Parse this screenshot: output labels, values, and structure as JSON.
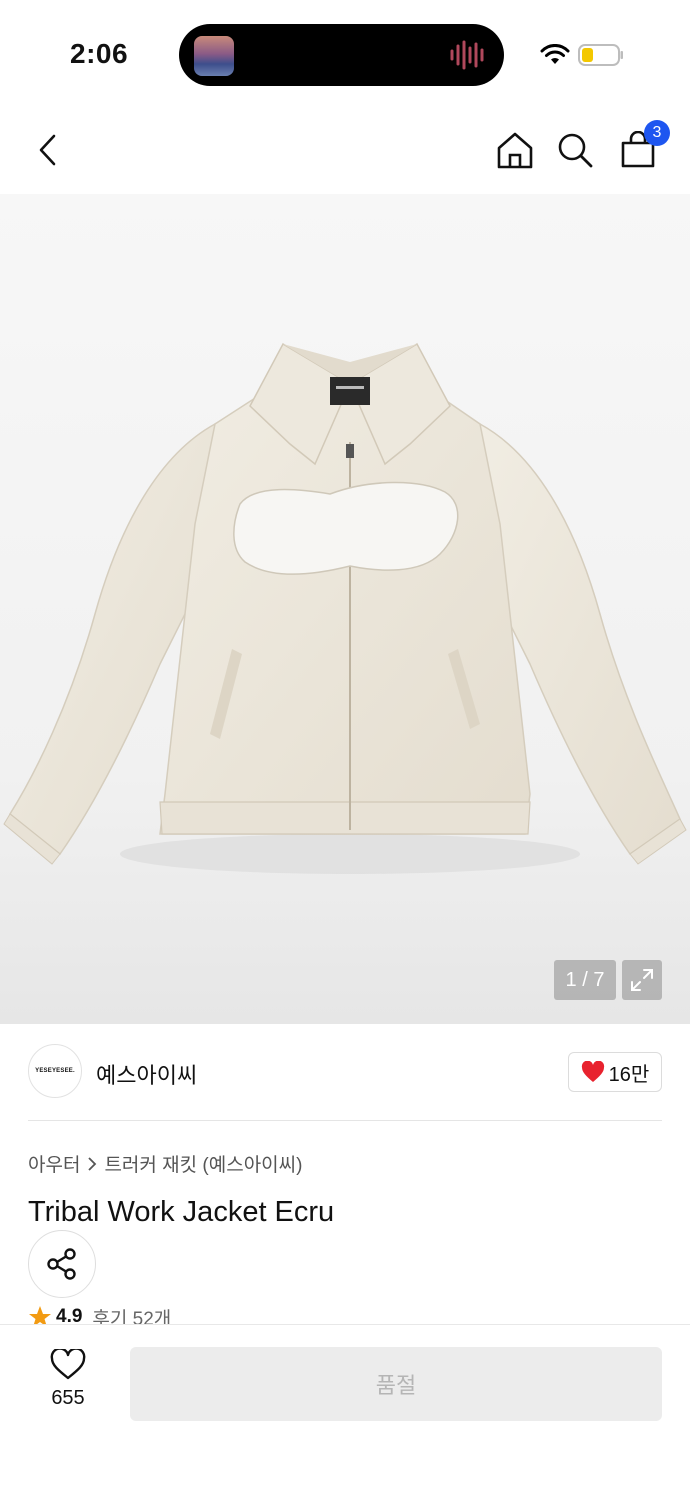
{
  "status": {
    "time": "2:06"
  },
  "nav": {
    "cart_count": "3"
  },
  "gallery": {
    "page_indicator": "1 / 7"
  },
  "brand": {
    "logo_text": "YESEYESEE.",
    "name": "예스아이씨",
    "likes": "16만"
  },
  "breadcrumb": {
    "category": "아우터",
    "subcategory": "트러커 재킷 (예스아이씨)"
  },
  "product": {
    "title": "Tribal Work Jacket Ecru",
    "rating": "4.9",
    "reviews": "후기 52개"
  },
  "bottom": {
    "wish_count": "655",
    "soldout_label": "품절"
  },
  "colors": {
    "accent_blue": "#1e56f0",
    "heart_red": "#e8222e",
    "star_orange": "#f29b13",
    "jacket_ecru": "#ece7dc"
  },
  "icons": [
    "back-icon",
    "home-icon",
    "search-icon",
    "cart-icon",
    "expand-icon",
    "heart-icon",
    "share-icon",
    "star-icon",
    "wifi-icon",
    "battery-icon"
  ]
}
